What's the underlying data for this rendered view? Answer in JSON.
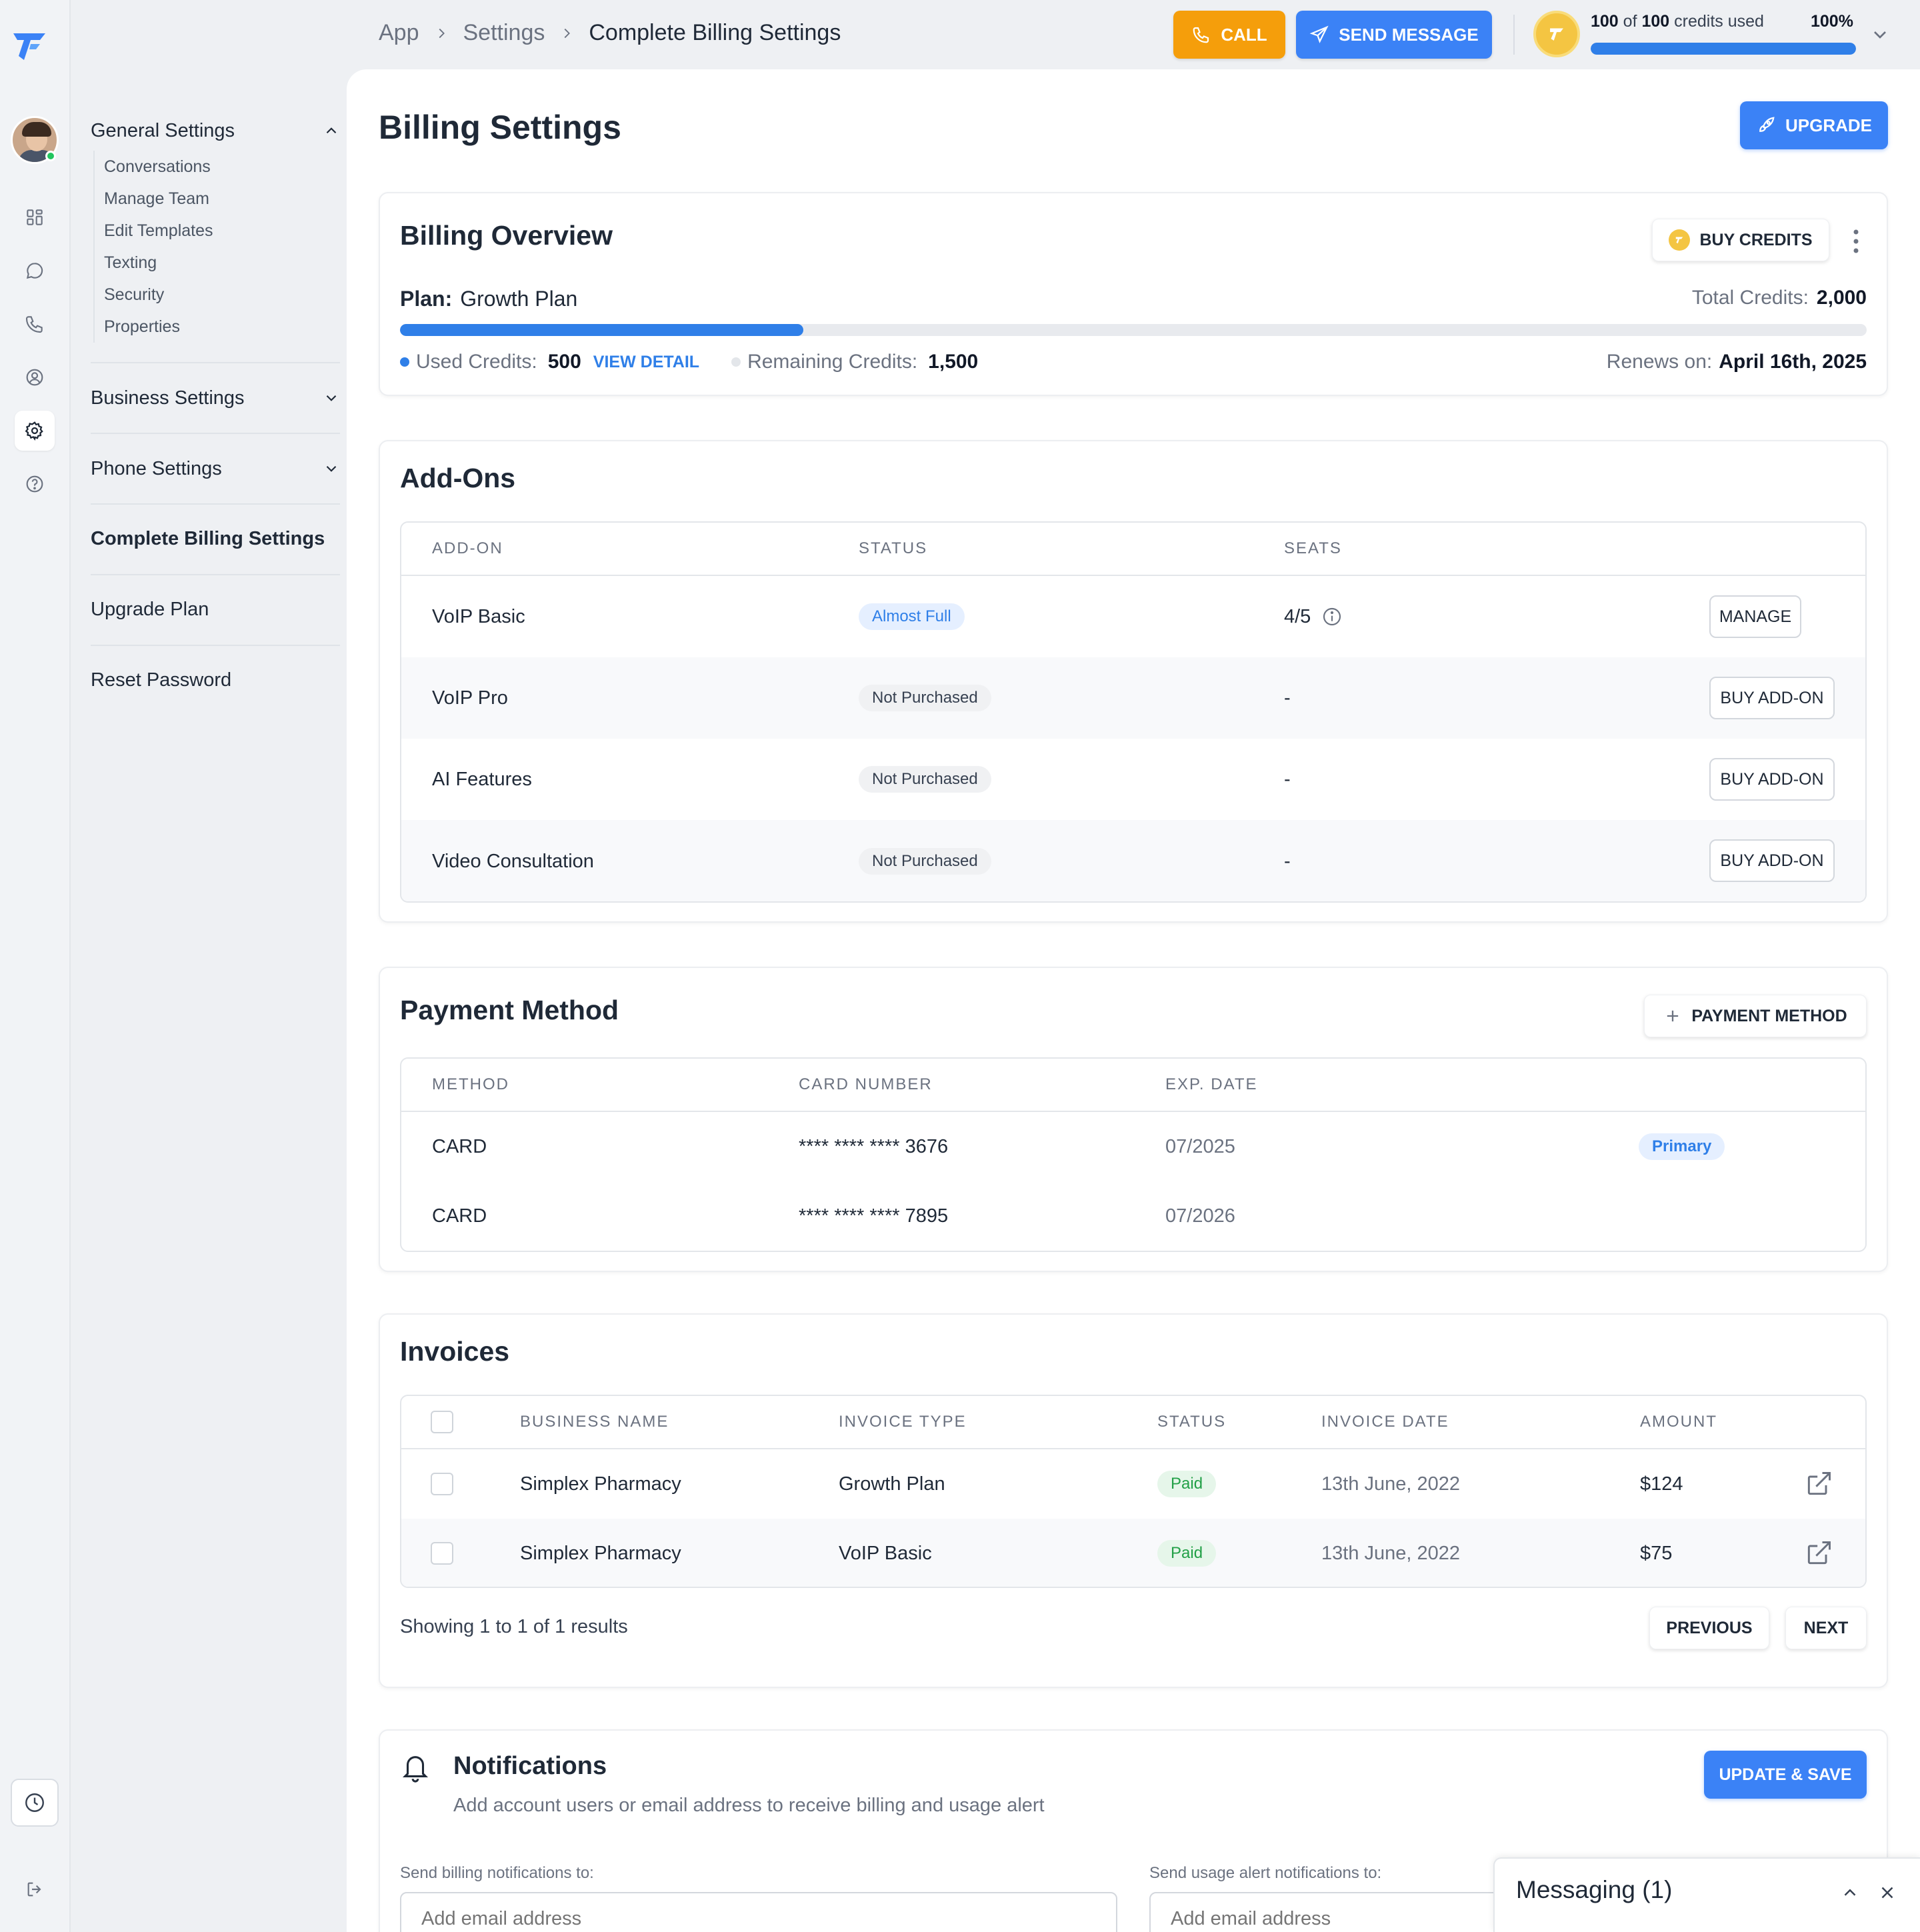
{
  "breadcrumb": [
    "App",
    "Settings",
    "Complete Billing Settings"
  ],
  "topbar": {
    "call_label": "CALL",
    "send_label": "SEND MESSAGE",
    "credits_used": "100",
    "credits_of": "of",
    "credits_total": "100",
    "credits_suffix": "credits used",
    "credits_pct": "100%",
    "credits_fraction": 1.0
  },
  "sidenav": {
    "general": {
      "label": "General Settings",
      "items": [
        "Conversations",
        "Manage Team",
        "Edit Templates",
        "Texting",
        "Security",
        "Properties"
      ]
    },
    "business": "Business Settings",
    "phone": "Phone Settings",
    "billing": "Complete Billing Settings",
    "upgrade": "Upgrade Plan",
    "reset": "Reset Password"
  },
  "page": {
    "title": "Billing Settings",
    "upgrade_label": "UPGRADE"
  },
  "overview": {
    "title": "Billing Overview",
    "buy_credits_label": "BUY CREDITS",
    "plan_label": "Plan:",
    "plan_value": "Growth Plan",
    "total_label": "Total Credits:",
    "total_value": "2,000",
    "used_fraction": 0.275,
    "used_label": "Used Credits:",
    "used_value": "500",
    "view_detail": "VIEW DETAIL",
    "remaining_label": "Remaining Credits:",
    "remaining_value": "1,500",
    "renews_label": "Renews on:",
    "renews_value": "April 16th, 2025"
  },
  "addons": {
    "title": "Add-Ons",
    "headers": [
      "ADD-ON",
      "STATUS",
      "SEATS"
    ],
    "rows": [
      {
        "name": "VoIP Basic",
        "status": "Almost Full",
        "seats": "4/5",
        "action": "MANAGE"
      },
      {
        "name": "VoIP Pro",
        "status": "Not Purchased",
        "seats": "-",
        "action": "BUY ADD-ON"
      },
      {
        "name": "AI Features",
        "status": "Not Purchased",
        "seats": "-",
        "action": "BUY ADD-ON"
      },
      {
        "name": "Video Consultation",
        "status": "Not Purchased",
        "seats": "-",
        "action": "BUY ADD-ON"
      }
    ]
  },
  "payment": {
    "title": "Payment Method",
    "add_label": "PAYMENT METHOD",
    "headers": [
      "METHOD",
      "CARD NUMBER",
      "EXP. DATE"
    ],
    "rows": [
      {
        "method": "CARD",
        "number": "**** **** **** 3676",
        "exp": "07/2025",
        "badge": "Primary"
      },
      {
        "method": "CARD",
        "number": "**** **** **** 7895",
        "exp": "07/2026",
        "badge": ""
      }
    ]
  },
  "invoices": {
    "title": "Invoices",
    "headers": [
      "BUSINESS NAME",
      "INVOICE TYPE",
      "STATUS",
      "INVOICE DATE",
      "AMOUNT"
    ],
    "rows": [
      {
        "business": "Simplex Pharmacy",
        "type": "Growth Plan",
        "status": "Paid",
        "date": "13th June, 2022",
        "amount": "$124"
      },
      {
        "business": "Simplex Pharmacy",
        "type": "VoIP Basic",
        "status": "Paid",
        "date": "13th June, 2022",
        "amount": "$75"
      }
    ],
    "showing": "Showing 1 to 1 of 1 results",
    "previous": "PREVIOUS",
    "next": "NEXT"
  },
  "notifications": {
    "title": "Notifications",
    "subtitle": "Add account users or email address to receive billing and usage alert",
    "save_label": "UPDATE & SAVE",
    "billing_label": "Send billing notifications to:",
    "billing_placeholder": "Add email address",
    "usage_label": "Send usage alert notifications to:",
    "usage_placeholder": "Add email address"
  },
  "messaging": {
    "title": "Messaging (1)"
  },
  "colors": {
    "accent": "#3b82f6",
    "call": "#f59e0b",
    "coin": "#f4c542",
    "paid": "#22a047"
  }
}
